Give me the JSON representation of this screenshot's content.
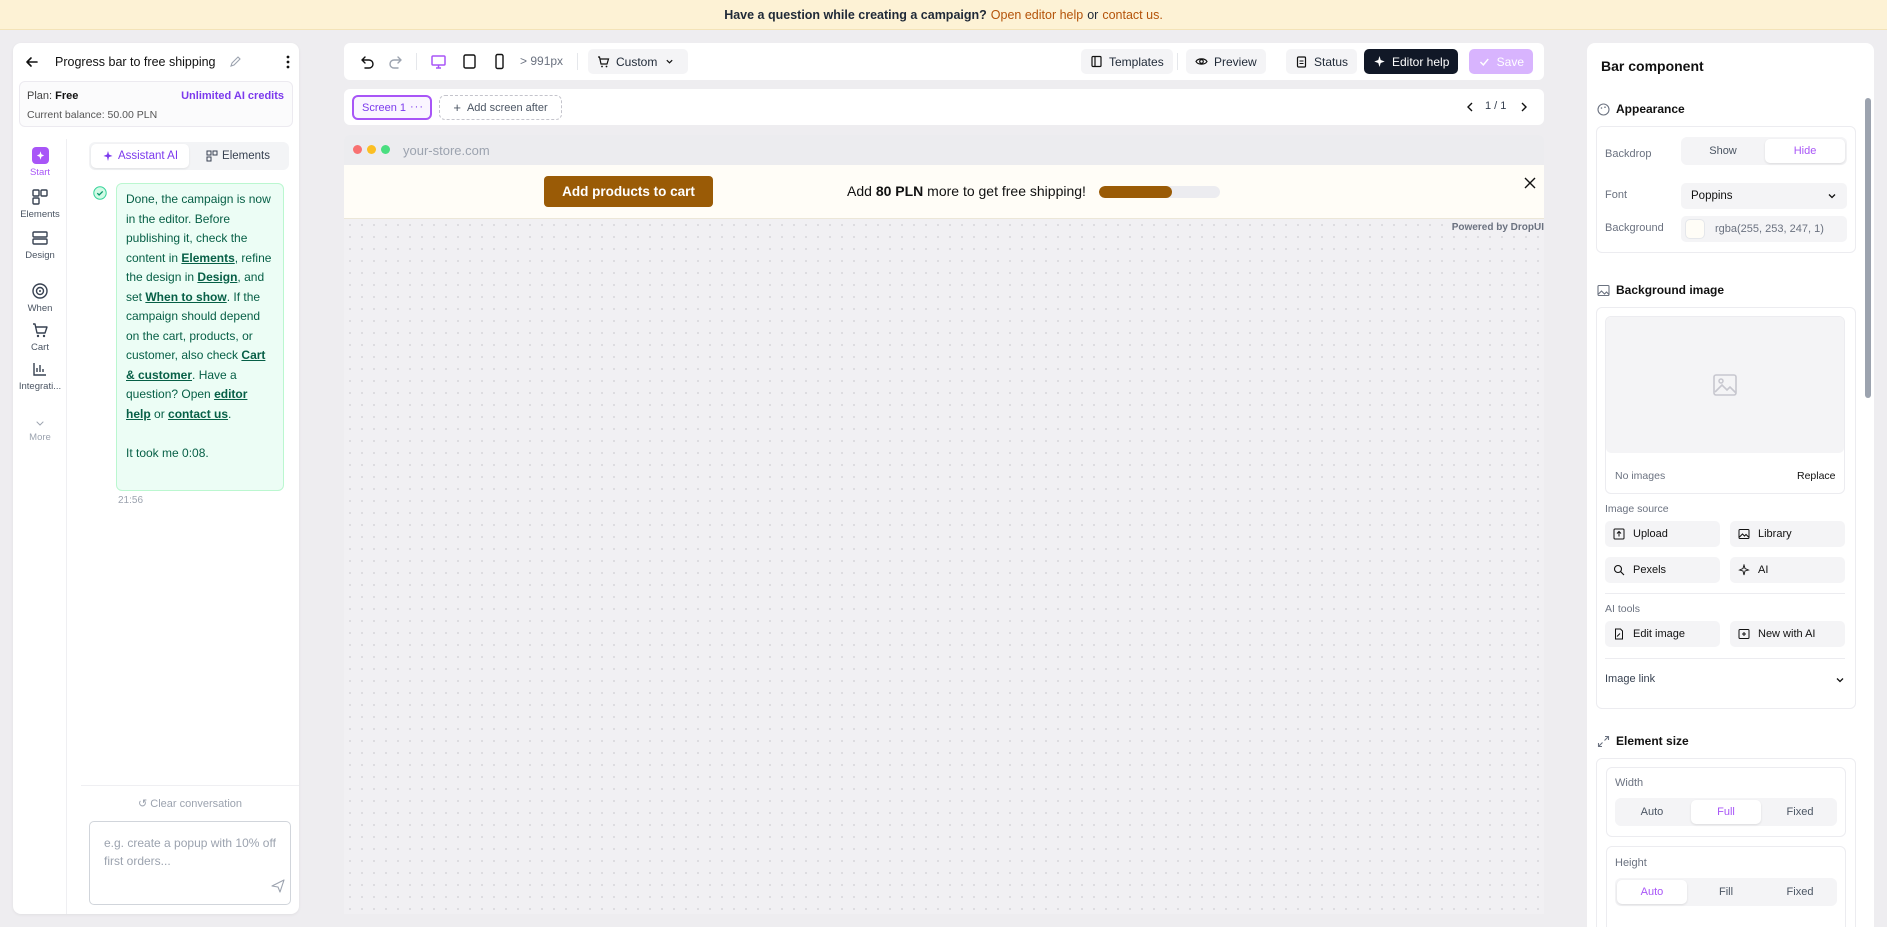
{
  "banner": {
    "question": "Have a question while creating a campaign?",
    "help_link": "Open editor help",
    "or": "or",
    "contact_link": "contact us."
  },
  "left_panel": {
    "title": "Progress bar to free shipping",
    "plan_label": "Plan:",
    "plan_value": "Free",
    "credits": "Unlimited AI credits",
    "balance": "Current balance: 50.00 PLN",
    "rail": [
      {
        "label": "Start",
        "icon": "sparkle-icon",
        "active": true
      },
      {
        "label": "Elements",
        "icon": "grid-icon"
      },
      {
        "label": "Design",
        "icon": "layers-icon"
      },
      {
        "label": "When",
        "icon": "target-icon"
      },
      {
        "label": "Cart",
        "icon": "cart-icon"
      },
      {
        "label": "Integrati...",
        "icon": "chart-icon"
      },
      {
        "label": "More",
        "icon": "chevron-down-icon"
      }
    ],
    "tabs": {
      "assistant": "Assistant AI",
      "elements": "Elements"
    },
    "message": {
      "p1": "Done, the campaign is now in the editor. Before publishing it, check the content in",
      "l_elements": "Elements",
      "p2": ", refine the design in",
      "l_design": "Design",
      "p3": ", and set",
      "l_when": "When to show",
      "p4": ". If the campaign should depend on the cart, products, or customer, also check",
      "l_cart": "Cart & customer",
      "p5": ". Have a question? Open",
      "l_help": "editor help",
      "p6": "or",
      "l_contact": "contact us",
      "p7": ".",
      "took": "It took me 0:08."
    },
    "timestamp": "21:56",
    "clear": "Clear conversation",
    "input_placeholder": "e.g. create a popup with 10% off first orders..."
  },
  "toolbar": {
    "breakpoint": "> 991px",
    "cart_mode": "Custom",
    "templates": "Templates",
    "preview": "Preview",
    "status": "Status",
    "editor_help": "Editor help",
    "save": "Save"
  },
  "screens": {
    "screen1": "Screen 1",
    "more": "···",
    "add": "Add screen after",
    "pagination": "1 / 1"
  },
  "canvas": {
    "url": "your-store.com",
    "cart_button": "Add products to cart",
    "ship_pre": "Add",
    "ship_amount": "80 PLN",
    "ship_post": "more to get free shipping!",
    "progress": 0.6,
    "powered": "Powered by DropUI",
    "colors": {
      "brand": "#9a5b06",
      "bar_bg": "#fffdf7"
    }
  },
  "right_panel": {
    "title": "Bar component",
    "appearance": "Appearance",
    "backdrop_label": "Backdrop",
    "backdrop_show": "Show",
    "backdrop_hide": "Hide",
    "font_label": "Font",
    "font_value": "Poppins",
    "background_label": "Background",
    "background_value": "rgba(255, 253, 247, 1)",
    "bg_image": "Background image",
    "no_images": "No images",
    "replace": "Replace",
    "image_source": "Image source",
    "upload": "Upload",
    "library": "Library",
    "pexels": "Pexels",
    "ai": "AI",
    "ai_tools": "AI tools",
    "edit_image": "Edit image",
    "new_with_ai": "New with AI",
    "image_link": "Image link",
    "element_size": "Element size",
    "width_label": "Width",
    "w_auto": "Auto",
    "w_full": "Full",
    "w_fixed": "Fixed",
    "height_label": "Height",
    "h_auto": "Auto",
    "h_fill": "Fill",
    "h_fixed": "Fixed",
    "accent": "#a855f7"
  }
}
